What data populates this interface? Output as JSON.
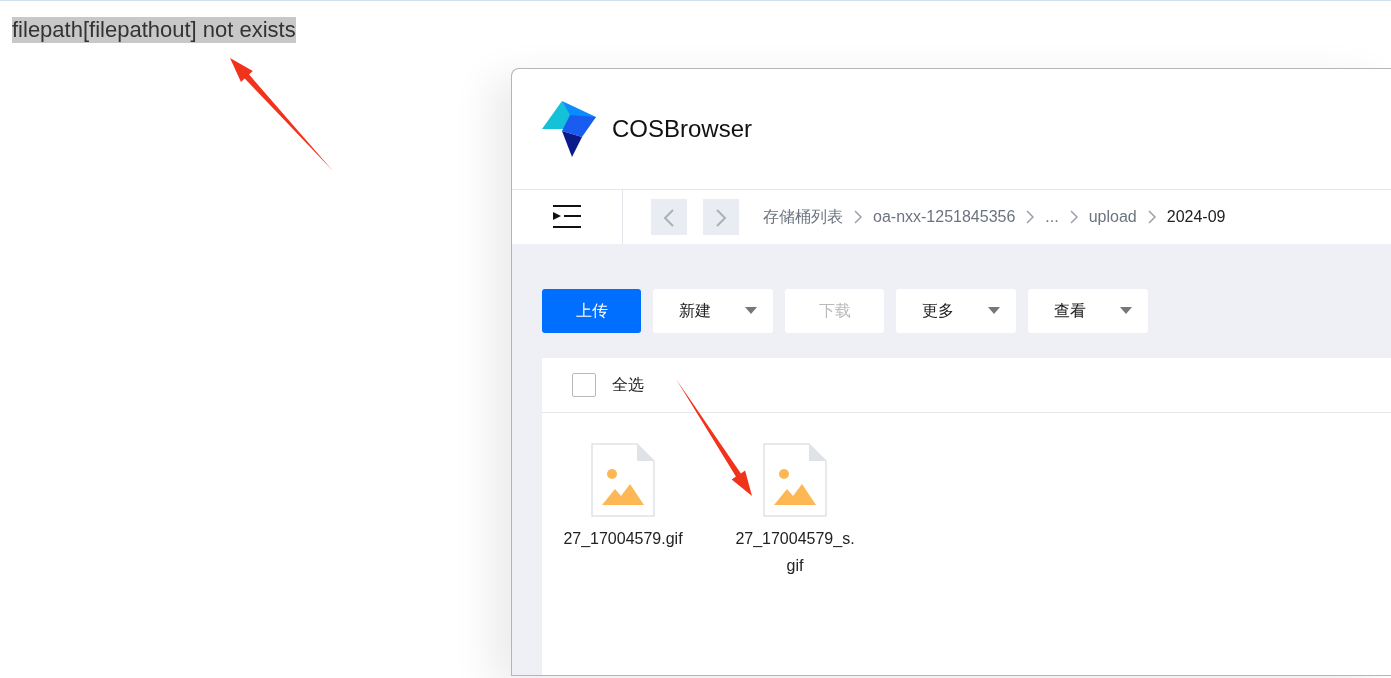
{
  "error_message": "filepath[filepathout] not exists",
  "app": {
    "title": "COSBrowser",
    "breadcrumb": [
      {
        "label": "存储桶列表",
        "current": false
      },
      {
        "label": "oa-nxx-1251845356",
        "current": false
      },
      {
        "label": "...",
        "current": false
      },
      {
        "label": "upload",
        "current": false
      },
      {
        "label": "2024-09",
        "current": true
      }
    ],
    "toolbar": [
      {
        "label": "上传",
        "kind": "primary",
        "disabled": false
      },
      {
        "label": "新建",
        "kind": "dropdown",
        "disabled": false
      },
      {
        "label": "下载",
        "kind": "plain",
        "disabled": true
      },
      {
        "label": "更多",
        "kind": "dropdown",
        "disabled": false
      },
      {
        "label": "查看",
        "kind": "dropdown",
        "disabled": false
      }
    ],
    "select_all": {
      "label": "全选",
      "checked": false
    },
    "files": [
      {
        "name": "27_17004579.gif"
      },
      {
        "name": "27_17004579_s.gif"
      }
    ]
  }
}
